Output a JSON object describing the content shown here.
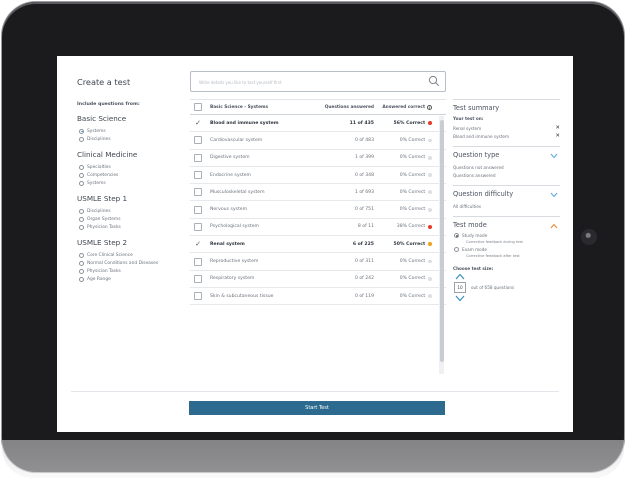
{
  "page": {
    "title": "Create a test",
    "search_placeholder": "Write details you like to test yourself first"
  },
  "left_panel": {
    "include_label": "Include questions from:",
    "groups": [
      {
        "title": "Basic Science",
        "options": [
          {
            "label": "Systems",
            "selected": true
          },
          {
            "label": "Disciplines",
            "selected": false
          }
        ]
      },
      {
        "title": "Clinical Medicine",
        "options": [
          {
            "label": "Specialties",
            "selected": false
          },
          {
            "label": "Competencies",
            "selected": false
          },
          {
            "label": "Systems",
            "selected": false
          }
        ]
      },
      {
        "title": "USMLE Step 1",
        "options": [
          {
            "label": "Disciplines",
            "selected": false
          },
          {
            "label": "Organ Systems",
            "selected": false
          },
          {
            "label": "Physician Tasks",
            "selected": false
          }
        ]
      },
      {
        "title": "USMLE Step 2",
        "options": [
          {
            "label": "Core Clinical Science",
            "selected": false
          },
          {
            "label": "Normal Conditions and Diseases",
            "selected": false
          },
          {
            "label": "Physician Tasks",
            "selected": false
          },
          {
            "label": "Age Range",
            "selected": false
          }
        ]
      }
    ]
  },
  "table": {
    "headers": {
      "name": "Basic Science - Systems",
      "questions": "Questions answered",
      "correct": "Answered correct"
    },
    "rows": [
      {
        "name": "Blood and immune system",
        "questions": "11 of 435",
        "correct": "56% Correct",
        "selected": true,
        "dot": "#e63b2e"
      },
      {
        "name": "Cardiovascular system",
        "questions": "0 of 483",
        "correct": "0% Correct",
        "selected": false,
        "dot": "#dcdfe3"
      },
      {
        "name": "Digestive system",
        "questions": "1 of 399",
        "correct": "0% Correct",
        "selected": false,
        "dot": "#dcdfe3"
      },
      {
        "name": "Endocrine system",
        "questions": "0 of 348",
        "correct": "0% Correct",
        "selected": false,
        "dot": "#dcdfe3"
      },
      {
        "name": "Musculoskeletal system",
        "questions": "1 of 693",
        "correct": "0% Correct",
        "selected": false,
        "dot": "#dcdfe3"
      },
      {
        "name": "Nervous system",
        "questions": "0 of 751",
        "correct": "0% Correct",
        "selected": false,
        "dot": "#dcdfe3"
      },
      {
        "name": "Psychological system",
        "questions": "8 of 11",
        "correct": "38% Correct",
        "selected": false,
        "dot": "#e63b2e"
      },
      {
        "name": "Renal system",
        "questions": "6 of 225",
        "correct": "50% Correct",
        "selected": true,
        "dot": "#f0a020"
      },
      {
        "name": "Reproductive system",
        "questions": "0 of 311",
        "correct": "0% Correct",
        "selected": false,
        "dot": "#dcdfe3"
      },
      {
        "name": "Respiratory system",
        "questions": "0 of 242",
        "correct": "0% Correct",
        "selected": false,
        "dot": "#dcdfe3"
      },
      {
        "name": "Skin & subcutaneous tissue",
        "questions": "0 of 119",
        "correct": "0% Correct",
        "selected": false,
        "dot": "#dcdfe3"
      }
    ]
  },
  "summary": {
    "title": "Test summary",
    "your_test_label": "Your test on:",
    "items": [
      "Renal system",
      "Blood and immune system"
    ],
    "question_type": {
      "title": "Question type",
      "lines": [
        "Questions not answered",
        "Questions answered"
      ]
    },
    "difficulty": {
      "title": "Question difficulty",
      "lines": [
        "All difficulties"
      ]
    },
    "test_mode": {
      "title": "Test mode",
      "modes": [
        {
          "label": "Study mode",
          "hint": "Corrective feedback during test",
          "selected": true
        },
        {
          "label": "Exam mode",
          "hint": "Corrective feedback after test",
          "selected": false
        }
      ]
    },
    "size": {
      "label": "Choose test size:",
      "value": "10",
      "suffix": "out of 658 questions"
    }
  },
  "start_button": "Start Test",
  "colors": {
    "accent": "#2d6a8f",
    "chevron": "#5aa9d6",
    "open_chevron": "#e8862a"
  }
}
